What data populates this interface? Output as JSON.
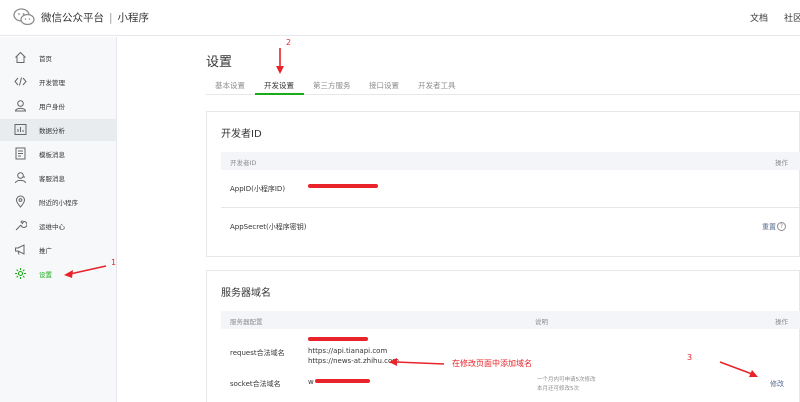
{
  "topbar": {
    "brand": "微信公众平台",
    "separator": "|",
    "product": "小程序",
    "docs": "文档",
    "community": "社区"
  },
  "sidebar": {
    "items": [
      {
        "label": "首页",
        "icon": "home-icon"
      },
      {
        "label": "开发管理",
        "icon": "code-icon"
      },
      {
        "label": "用户身份",
        "icon": "user-icon"
      },
      {
        "label": "数据分析",
        "icon": "chart-icon"
      },
      {
        "label": "模板消息",
        "icon": "document-icon"
      },
      {
        "label": "客服消息",
        "icon": "support-icon"
      },
      {
        "label": "附近的小程序",
        "icon": "location-pin-icon"
      },
      {
        "label": "运维中心",
        "icon": "wrench-icon"
      },
      {
        "label": "推广",
        "icon": "megaphone-icon"
      },
      {
        "label": "设置",
        "icon": "gear-icon"
      }
    ],
    "active_label": "设置",
    "accent_color": "#1aad19"
  },
  "page": {
    "title": "设置",
    "tabs": [
      "基本设置",
      "开发设置",
      "第三方服务",
      "接口设置",
      "开发者工具"
    ],
    "active_tab": "开发设置"
  },
  "developer_id": {
    "title": "开发者ID",
    "col_id": "开发者ID",
    "col_action": "操作",
    "appid_label": "AppID(小程序ID)",
    "secret_label": "AppSecret(小程序密钥)",
    "reset_link": "重置",
    "help_glyph": "?"
  },
  "server_domain": {
    "title": "服务器域名",
    "col_config": "服务器配置",
    "col_desc": "说明",
    "col_action": "操作",
    "request_label": "request合法域名",
    "request_values": [
      "https://api.tianapi.com",
      "https://news-at.zhihu.com"
    ],
    "socket_label": "socket合法域名",
    "socket_value": "w",
    "limit_hint_1": "一个月内可申请5次修改",
    "limit_hint_2": "本月还可修改5次",
    "modify_link": "修改"
  },
  "annotations": {
    "n1": "1",
    "n2": "2",
    "n3": "3",
    "add_domain_note": "在修改页面中添加域名",
    "color": "#e8242a"
  }
}
